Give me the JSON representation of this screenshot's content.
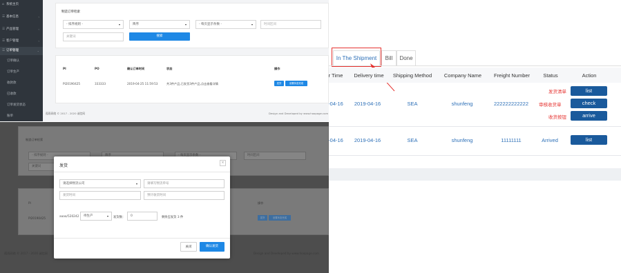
{
  "shot1": {
    "sidebar": {
      "items": [
        {
          "icon": "⌂",
          "label": "系统主页",
          "arrow": ""
        },
        {
          "icon": "☰",
          "label": "基本信息",
          "arrow": "‹"
        },
        {
          "icon": "☰",
          "label": "产品管理",
          "arrow": "‹"
        },
        {
          "icon": "☰",
          "label": "客户管理",
          "arrow": "‹"
        },
        {
          "icon": "☰",
          "label": "订单管理",
          "arrow": "⌄"
        }
      ],
      "subitems": [
        "订单确认",
        "订单生产",
        "收款款",
        "已收款",
        "订单发货状态",
        "账单"
      ]
    },
    "filter": {
      "title": "制造订单检索",
      "select1": "- 排序规则 -",
      "select2": "降序",
      "select3": "- 每页显示条数 -",
      "date_placeholder": "时间区间",
      "keyword_placeholder": "关键词",
      "search_label": "搜索"
    },
    "table": {
      "headers": [
        "PI",
        "PO",
        "确认订单时间",
        "状态",
        "操作"
      ],
      "row": {
        "pi": "PI20190425",
        "po": "333333",
        "time": "2019-04-25 11:59:53",
        "status": "共3件产品,已发货3件产品,点击查看详情",
        "btn1": "发货",
        "btn2": "设置状态完成"
      }
    },
    "footer_left": "孤雨网络 © 2017 - 2020 诚信网",
    "footer_right": "Design and Developed by www.hoopage.com"
  },
  "shot2": {
    "bg_title": "制造订单检索",
    "bg_select1": "- 排序规则 -",
    "bg_select2": "降序",
    "bg_select3": "- 每页显示条数 -",
    "bg_date": "时间区间",
    "bg_keyword": "关键词",
    "bg_header_pi": "PI",
    "bg_header_op": "操作",
    "bg_pi": "PI20190425",
    "bg_btn1": "发货",
    "bg_btn2": "设置状态完成",
    "bg_footer_left": "孤雨网络 © 2017 - 2020 诚信网",
    "bg_footer_right": "Design and Developed by www.hoopage.com",
    "modal": {
      "title": "发货",
      "close": "×",
      "company_select": "请选择物流公司",
      "tracking_placeholder": "请填写物流单号",
      "ship_time_placeholder": "发货时间",
      "arrival_placeholder": "预计收货时间",
      "product": "aaaa/520242",
      "status_select": "待生产",
      "qty_label": "发货数：",
      "qty_value": "0",
      "remaining": "剩余应发货 3 件",
      "cancel": "关闭",
      "confirm": "确认发货"
    }
  },
  "shot3": {
    "tabs": [
      "In The Shipment",
      "Bill",
      "Done"
    ],
    "headers": [
      "r Time",
      "Delivery time",
      "Shipping Method",
      "Company Name",
      "Freight Number",
      "Status",
      "Action"
    ],
    "rows": [
      {
        "order_time": "-04-16",
        "delivery": "2019-04-16",
        "method": "SEA",
        "company": "shunfeng",
        "freight": "222222222222",
        "status": "",
        "actions": [
          "list",
          "check",
          "arrive"
        ],
        "labels": [
          "发货清单",
          "审核收货单",
          "收货按钮"
        ]
      },
      {
        "order_time": "-04-16",
        "delivery": "2019-04-16",
        "method": "SEA",
        "company": "shunfeng",
        "freight": "11111111",
        "status": "Arrived",
        "actions": [
          "list"
        ]
      }
    ],
    "colors": {
      "accent_blue": "#2c6fb7",
      "button_blue": "#1a5a9c",
      "annotation_red": "#e5312e"
    }
  }
}
